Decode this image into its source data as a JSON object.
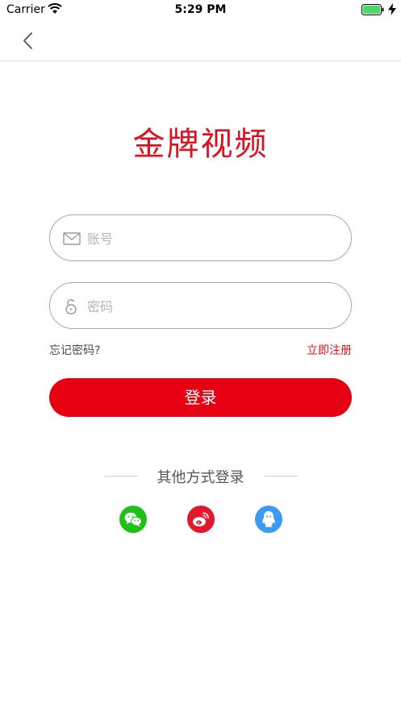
{
  "status_bar": {
    "carrier": "Carrier",
    "time": "5:29 PM"
  },
  "logo": {
    "text": "金牌视频"
  },
  "login_form": {
    "account_placeholder": "账号",
    "password_placeholder": "密码",
    "forgot_password": "忘记密码?",
    "register": "立即注册",
    "login_button": "登录"
  },
  "other_login": {
    "title": "其他方式登录",
    "providers": [
      "wechat",
      "weibo",
      "qq"
    ]
  },
  "colors": {
    "brand_red": "#e60012",
    "wechat": "#1ec217",
    "weibo": "#e6162d",
    "qq": "#3d99f3"
  },
  "icons": {
    "back": "chevron-left-icon",
    "account": "envelope-icon",
    "password": "lock-icon"
  }
}
